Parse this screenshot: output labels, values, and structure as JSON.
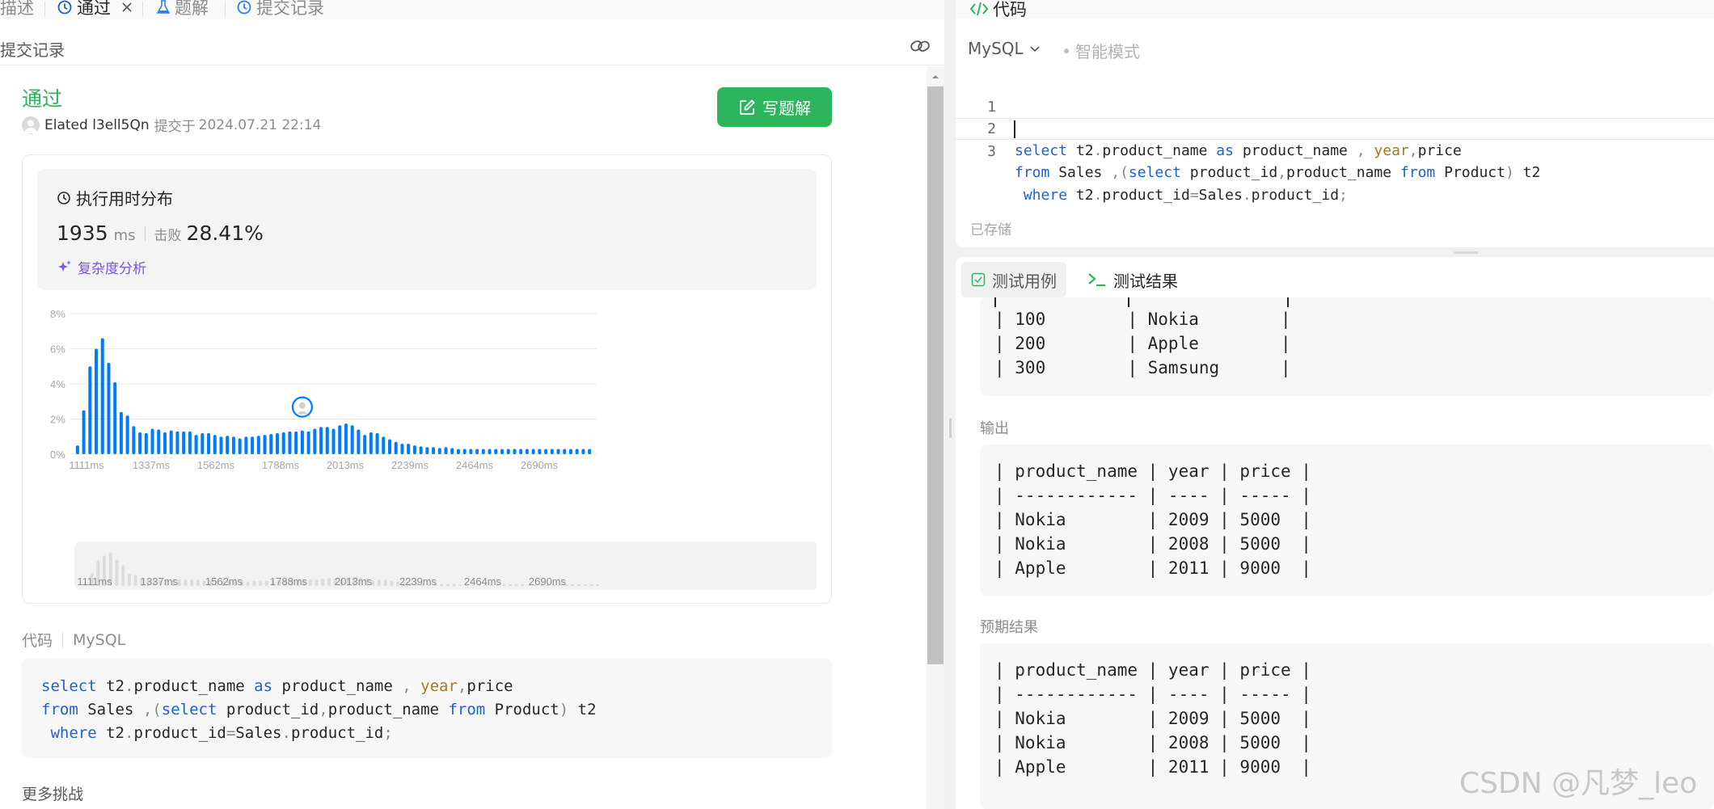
{
  "left_tabs": [
    {
      "label": "描述",
      "active": false
    },
    {
      "label": "通过",
      "active": true,
      "closable": true
    },
    {
      "label": "题解",
      "active": false
    },
    {
      "label": "提交记录",
      "active": false
    }
  ],
  "subheader": {
    "title": "提交记录"
  },
  "submission": {
    "status": "通过",
    "author": "Elated l3ell5Qn",
    "submitted_prefix": "提交于",
    "submitted_at": "2024.07.21 22:14",
    "write_solution_label": "写题解"
  },
  "runtime_card": {
    "title": "执行用时分布",
    "value": "1935",
    "unit": "ms",
    "beats_label": "击败",
    "beats_pct": "28.41%",
    "complexity_label": "复杂度分析"
  },
  "chart_data": {
    "type": "bar",
    "x_tick_labels": [
      "1111ms",
      "1337ms",
      "1562ms",
      "1788ms",
      "2013ms",
      "2239ms",
      "2464ms",
      "2690ms"
    ],
    "y_tick_labels": [
      "0%",
      "2%",
      "4%",
      "6%",
      "8%"
    ],
    "ylim": [
      0,
      8
    ],
    "values": [
      0.5,
      2.5,
      5.0,
      6.0,
      6.6,
      5.2,
      4.1,
      2.4,
      2.2,
      1.6,
      1.25,
      1.2,
      1.45,
      1.4,
      1.25,
      1.35,
      1.3,
      1.3,
      1.3,
      1.1,
      1.2,
      1.2,
      1.1,
      1.0,
      1.05,
      1.0,
      0.9,
      1.0,
      1.0,
      1.05,
      1.1,
      1.15,
      1.2,
      1.25,
      1.3,
      1.3,
      1.35,
      1.3,
      1.45,
      1.55,
      1.55,
      1.45,
      1.65,
      1.75,
      1.65,
      1.4,
      1.1,
      1.25,
      1.2,
      1.0,
      0.85,
      0.7,
      0.6,
      0.6,
      0.5,
      0.45,
      0.4,
      0.4,
      0.35,
      0.4,
      0.35,
      0.3,
      0.3,
      0.3,
      0.3,
      0.3,
      0.3,
      0.3,
      0.3,
      0.3,
      0.3,
      0.3,
      0.3,
      0.3,
      0.3,
      0.3,
      0.3,
      0.3,
      0.3,
      0.3,
      0.3,
      0.3,
      0.3
    ],
    "highlight_index": 36,
    "bar_color": "#007aff",
    "grid": true
  },
  "code_section": {
    "label": "代码",
    "language": "MySQL",
    "lines": [
      "select t2.product_name as product_name , year,price",
      "from Sales ,(select product_id,product_name from Product) t2",
      " where t2.product_id=Sales.product_id;"
    ]
  },
  "more_label": "更多挑战",
  "right_top": {
    "title": "代码",
    "language": "MySQL",
    "smart_mode": "智能模式",
    "saved_label": "已存储",
    "line_numbers": [
      "1",
      "2",
      "3"
    ]
  },
  "right_bottom": {
    "tabs": [
      {
        "label": "测试用例"
      },
      {
        "label": "测试结果"
      }
    ],
    "input_rows": [
      "| 100        | Nokia        |",
      "| 200        | Apple        |",
      "| 300        | Samsung      |"
    ],
    "output_label": "输出",
    "output_rows": [
      "| product_name | year | price |",
      "| ------------ | ---- | ----- |",
      "| Nokia        | 2009 | 5000  |",
      "| Nokia        | 2008 | 5000  |",
      "| Apple        | 2011 | 9000  |"
    ],
    "expected_label": "预期结果",
    "expected_rows": [
      "| product_name | year | price |",
      "| ------------ | ---- | ----- |",
      "| Nokia        | 2009 | 5000  |",
      "| Nokia        | 2008 | 5000  |",
      "| Apple        | 2011 | 9000  |"
    ]
  },
  "watermark": "CSDN @凡梦_leo",
  "colors": {
    "accent_green": "#2db55d",
    "chart_blue": "#007aff",
    "complexity_purple": "#7a55d9"
  }
}
